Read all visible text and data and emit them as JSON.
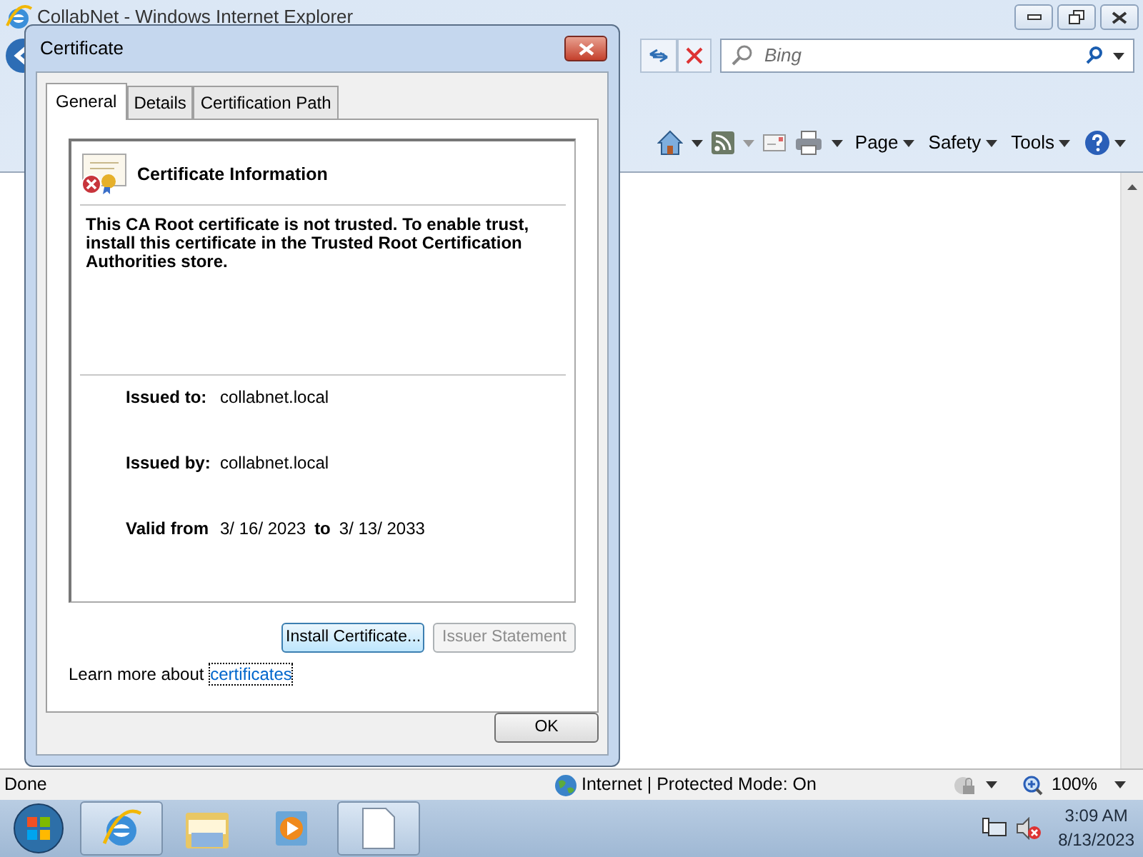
{
  "browser": {
    "title": "CollabNet - Windows Internet Explorer",
    "search": {
      "placeholder": "Bing"
    },
    "command_bar": [
      {
        "label": "Page"
      },
      {
        "label": "Safety"
      },
      {
        "label": "Tools"
      }
    ],
    "status_bar": {
      "status": "Done",
      "zone": "Internet | Protected Mode: On",
      "zoom": "100%"
    }
  },
  "dialog": {
    "title": "Certificate",
    "tabs": [
      {
        "label": "General",
        "selected": true
      },
      {
        "label": "Details",
        "selected": false
      },
      {
        "label": "Certification Path",
        "selected": false
      }
    ],
    "heading": "Certificate Information",
    "message": "This CA Root certificate is not trusted. To enable trust, install this certificate in the Trusted Root Certification Authorities store.",
    "fields": [
      {
        "label": "Issued to:",
        "value": "collabnet.local"
      },
      {
        "label": "Issued by:",
        "value": "collabnet.local"
      }
    ],
    "validity": {
      "label": "Valid from",
      "from": "3/ 16/ 2023",
      "joiner": "to",
      "to": "3/ 13/ 2033"
    },
    "buttons": [
      {
        "label": "Install Certificate...",
        "disabled": false
      },
      {
        "label": "Issuer Statement",
        "disabled": true
      }
    ],
    "learn_more": {
      "text": "Learn more about",
      "link": "certificates"
    },
    "ok": "OK"
  },
  "taskbar": {
    "time": "3:09 AM",
    "date": "8/13/2023"
  }
}
